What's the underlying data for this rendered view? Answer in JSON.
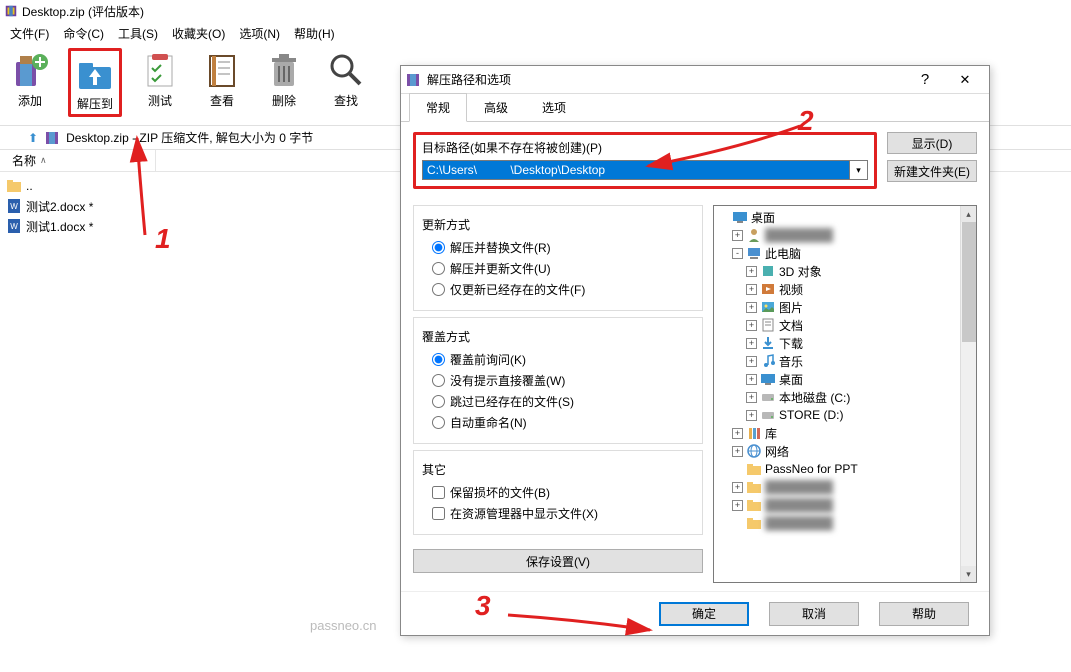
{
  "main": {
    "title": "Desktop.zip (评估版本)",
    "menu": [
      "文件(F)",
      "命令(C)",
      "工具(S)",
      "收藏夹(O)",
      "选项(N)",
      "帮助(H)"
    ],
    "toolbar": {
      "add": "添加",
      "extract_to": "解压到",
      "test": "测试",
      "view": "查看",
      "delete": "删除",
      "find": "查找"
    },
    "path_text": "Desktop.zip - ZIP 压缩文件, 解包大小为 0 字节",
    "col_name": "名称",
    "files": [
      {
        "name": ".."
      },
      {
        "name": "测试2.docx *"
      },
      {
        "name": "测试1.docx *"
      }
    ]
  },
  "dialog": {
    "title": "解压路径和选项",
    "tabs": [
      "常规",
      "高级",
      "选项"
    ],
    "path_label": "目标路径(如果不存在将被创建)(P)",
    "path_value": "C:\\Users\\          \\Desktop\\Desktop",
    "show_btn": "显示(D)",
    "newfolder_btn": "新建文件夹(E)",
    "update_mode": {
      "label": "更新方式",
      "opts": [
        "解压并替换文件(R)",
        "解压并更新文件(U)",
        "仅更新已经存在的文件(F)"
      ]
    },
    "overwrite_mode": {
      "label": "覆盖方式",
      "opts": [
        "覆盖前询问(K)",
        "没有提示直接覆盖(W)",
        "跳过已经存在的文件(S)",
        "自动重命名(N)"
      ]
    },
    "misc": {
      "label": "其它",
      "opts": [
        "保留损坏的文件(B)",
        "在资源管理器中显示文件(X)"
      ]
    },
    "save_settings": "保存设置(V)",
    "tree": {
      "items": [
        {
          "indent": 0,
          "exp": "",
          "icon": "desktop",
          "label": "桌面"
        },
        {
          "indent": 1,
          "exp": "+",
          "icon": "user",
          "label": "",
          "blur": true
        },
        {
          "indent": 1,
          "exp": "-",
          "icon": "pc",
          "label": "此电脑"
        },
        {
          "indent": 2,
          "exp": "+",
          "icon": "3d",
          "label": "3D 对象"
        },
        {
          "indent": 2,
          "exp": "+",
          "icon": "video",
          "label": "视频"
        },
        {
          "indent": 2,
          "exp": "+",
          "icon": "pic",
          "label": "图片"
        },
        {
          "indent": 2,
          "exp": "+",
          "icon": "doc",
          "label": "文档"
        },
        {
          "indent": 2,
          "exp": "+",
          "icon": "dl",
          "label": "下载"
        },
        {
          "indent": 2,
          "exp": "+",
          "icon": "music",
          "label": "音乐"
        },
        {
          "indent": 2,
          "exp": "+",
          "icon": "desktop",
          "label": "桌面"
        },
        {
          "indent": 2,
          "exp": "+",
          "icon": "disk",
          "label": "本地磁盘 (C:)"
        },
        {
          "indent": 2,
          "exp": "+",
          "icon": "disk",
          "label": "STORE (D:)"
        },
        {
          "indent": 1,
          "exp": "+",
          "icon": "lib",
          "label": "库"
        },
        {
          "indent": 1,
          "exp": "+",
          "icon": "net",
          "label": "网络"
        },
        {
          "indent": 1,
          "exp": "",
          "icon": "folder",
          "label": "PassNeo for PPT"
        },
        {
          "indent": 1,
          "exp": "+",
          "icon": "folder",
          "label": "",
          "blur": true
        },
        {
          "indent": 1,
          "exp": "+",
          "icon": "folder",
          "label": "",
          "blur": true
        },
        {
          "indent": 1,
          "exp": "",
          "icon": "folder",
          "label": "",
          "blur": true
        }
      ]
    },
    "footer": {
      "ok": "确定",
      "cancel": "取消",
      "help": "帮助"
    }
  },
  "annotations": {
    "n1": "1",
    "n2": "2",
    "n3": "3"
  },
  "watermark": "passneo.cn"
}
